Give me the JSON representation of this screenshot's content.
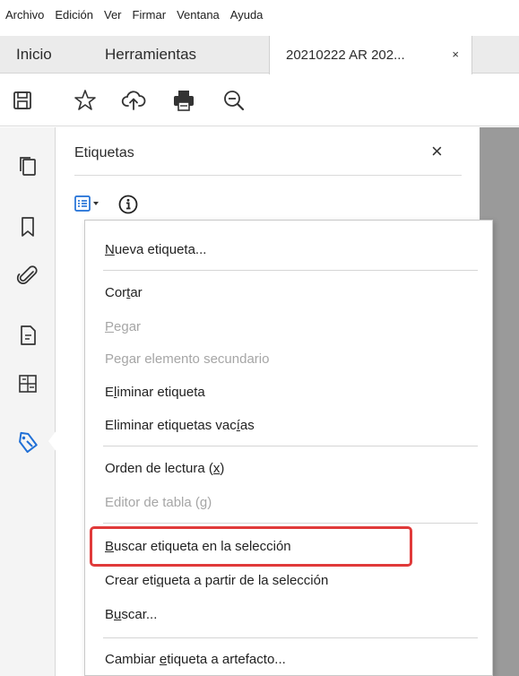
{
  "menubar": {
    "items": [
      "Archivo",
      "Edición",
      "Ver",
      "Firmar",
      "Ventana",
      "Ayuda"
    ]
  },
  "tabs": {
    "home": "Inicio",
    "tools": "Herramientas",
    "document": "20210222 AR 202...",
    "close": "×"
  },
  "toolbar": {
    "icons": [
      "save-icon",
      "star-icon",
      "upload-cloud-icon",
      "print-icon",
      "zoom-out-icon"
    ]
  },
  "leftrail": {
    "icons": [
      "pages-icon",
      "bookmark-icon",
      "attachment-icon",
      "document-properties-icon",
      "order-icon",
      "tag-icon"
    ],
    "active": "tag-icon"
  },
  "panel": {
    "title": "Etiquetas",
    "close": "×",
    "options_icon": "tag-options-icon",
    "info_icon": "info-icon"
  },
  "context_menu": {
    "new_tag": {
      "pre": "",
      "u": "N",
      "post": "ueva etiqueta..."
    },
    "cut": {
      "pre": "Cor",
      "u": "t",
      "post": "ar"
    },
    "paste": {
      "pre": "",
      "u": "P",
      "post": "egar"
    },
    "paste_child": {
      "label": "Pegar elemento secundario"
    },
    "delete_tag": {
      "pre": "E",
      "u": "l",
      "post": "iminar etiqueta"
    },
    "delete_empty": {
      "pre": "Eliminar etiquetas vac",
      "u": "í",
      "post": "as"
    },
    "reading_order": {
      "pre": "Orden de lectura (",
      "u": "x",
      "post": ")"
    },
    "table_editor": {
      "pre": "Editor de tabla (",
      "u": "g",
      "post": ")"
    },
    "find_in_selection": {
      "pre": "",
      "u": "B",
      "post": "uscar etiqueta en la selección"
    },
    "create_from_selection": {
      "pre": "Crear eti",
      "u": "q",
      "post": "ueta a partir de la selección"
    },
    "find": {
      "pre": "B",
      "u": "u",
      "post": "scar..."
    },
    "change_to_artifact": {
      "pre": "Cambiar ",
      "u": "e",
      "post": "tiqueta a artefacto..."
    }
  },
  "colors": {
    "highlight": "#e03a3a",
    "tag_icon": "#1f6fd6"
  }
}
